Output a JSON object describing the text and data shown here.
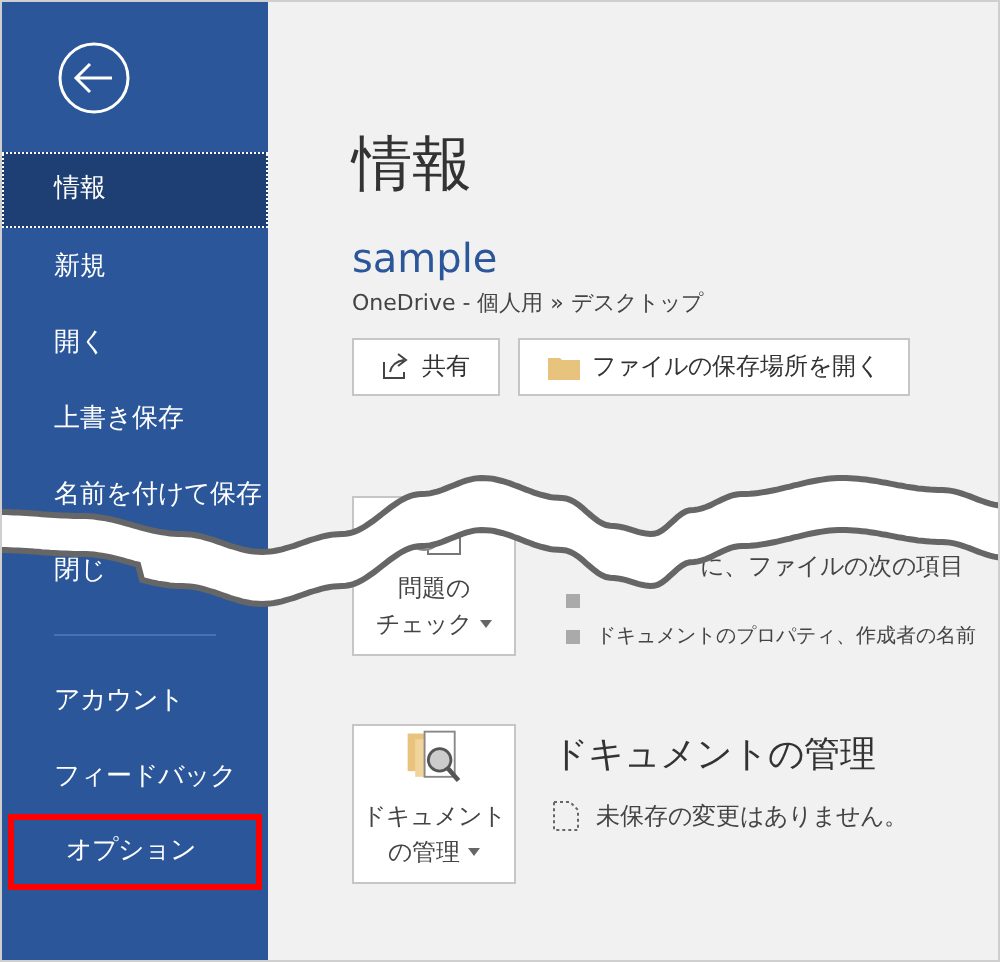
{
  "sidebar": {
    "items": [
      {
        "label": "情報",
        "selected": true,
        "highlighted": false
      },
      {
        "label": "新規",
        "selected": false,
        "highlighted": false
      },
      {
        "label": "開く",
        "selected": false,
        "highlighted": false
      },
      {
        "label": "上書き保存",
        "selected": false,
        "highlighted": false
      },
      {
        "label": "名前を付けて保存",
        "selected": false,
        "highlighted": false
      },
      {
        "label": "閉じ",
        "selected": false,
        "highlighted": false
      }
    ],
    "bottom_items": [
      {
        "label": "アカウント",
        "selected": false,
        "highlighted": false
      },
      {
        "label": "フィードバック",
        "selected": false,
        "highlighted": false
      },
      {
        "label": "オプション",
        "selected": false,
        "highlighted": true
      }
    ]
  },
  "main": {
    "title": "情報",
    "file_name": "sample",
    "location": "OneDrive - 個人用 » デスクトップ",
    "actions": [
      {
        "label": "共有",
        "kind": "share"
      },
      {
        "label": "ファイルの保存場所を開く",
        "kind": "folder"
      }
    ],
    "inspect": {
      "button_lines": [
        "問題の",
        "チェック"
      ],
      "text": "に、ファイルの次の項目",
      "bullets": [
        "ドキュメントのプロパティ、作成者の名前"
      ]
    },
    "manage": {
      "button_lines": [
        "ドキュメント",
        "の管理"
      ],
      "heading": "ドキュメントの管理",
      "status": "未保存の変更はありません。"
    }
  }
}
